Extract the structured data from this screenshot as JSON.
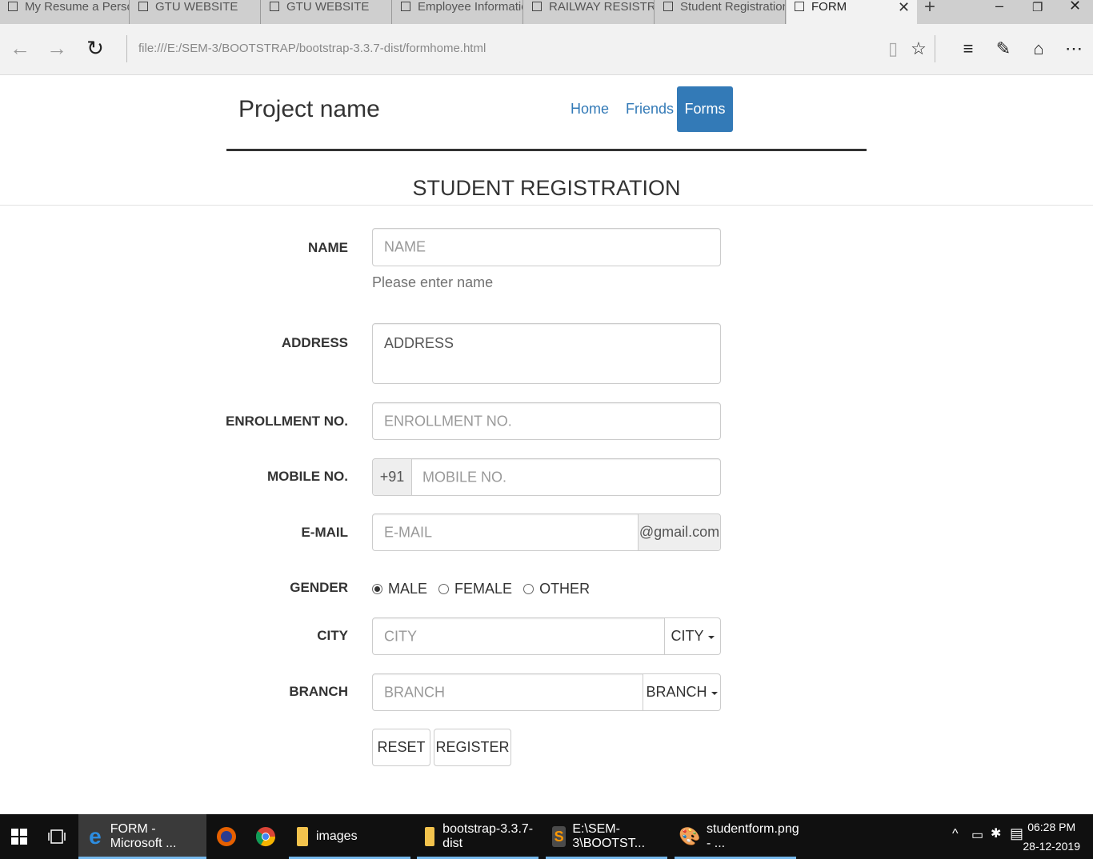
{
  "browser": {
    "tabs": [
      {
        "label": "My Resume a Persona"
      },
      {
        "label": "GTU WEBSITE"
      },
      {
        "label": "GTU WEBSITE"
      },
      {
        "label": "Employee Information"
      },
      {
        "label": "RAILWAY RESISTRATIC"
      },
      {
        "label": "Student Registration"
      },
      {
        "label": "FORM"
      }
    ],
    "url": "file:///E:/SEM-3/BOOTSTRAP/bootstrap-3.3.7-dist/formhome.html"
  },
  "navbar": {
    "brand": "Project name",
    "links": [
      {
        "label": "Home"
      },
      {
        "label": "Friends"
      },
      {
        "label": "Forms"
      }
    ]
  },
  "form": {
    "title": "STUDENT REGISTRATION",
    "name": {
      "label": "NAME",
      "placeholder": "NAME",
      "help": "Please enter name"
    },
    "address": {
      "label": "ADDRESS",
      "placeholder": "ADDRESS"
    },
    "enrollment": {
      "label": "ENROLLMENT NO.",
      "placeholder": "ENROLLMENT NO."
    },
    "mobile": {
      "label": "MOBILE NO.",
      "prefix": "+91",
      "placeholder": "MOBILE NO."
    },
    "email": {
      "label": "E-MAIL",
      "placeholder": "E-MAIL",
      "suffix": "@gmail.com"
    },
    "gender": {
      "label": "GENDER",
      "options": [
        "MALE",
        "FEMALE",
        "OTHER"
      ],
      "selected": "MALE"
    },
    "city": {
      "label": "CITY",
      "placeholder": "CITY",
      "dropdown": "CITY"
    },
    "branch": {
      "label": "BRANCH",
      "placeholder": "BRANCH",
      "dropdown": "BRANCH"
    },
    "buttons": {
      "reset": "RESET",
      "register": "REGISTER"
    }
  },
  "taskbar": {
    "items": [
      {
        "label": "FORM - Microsoft ..."
      },
      {
        "label": "images"
      },
      {
        "label": "bootstrap-3.3.7-dist"
      },
      {
        "label": "E:\\SEM-3\\BOOTST..."
      },
      {
        "label": "studentform.png - ..."
      }
    ],
    "time": "06:28 PM",
    "date": "28-12-2019"
  },
  "colors": {
    "primary": "#337ab7",
    "taskbar": "#101010"
  }
}
